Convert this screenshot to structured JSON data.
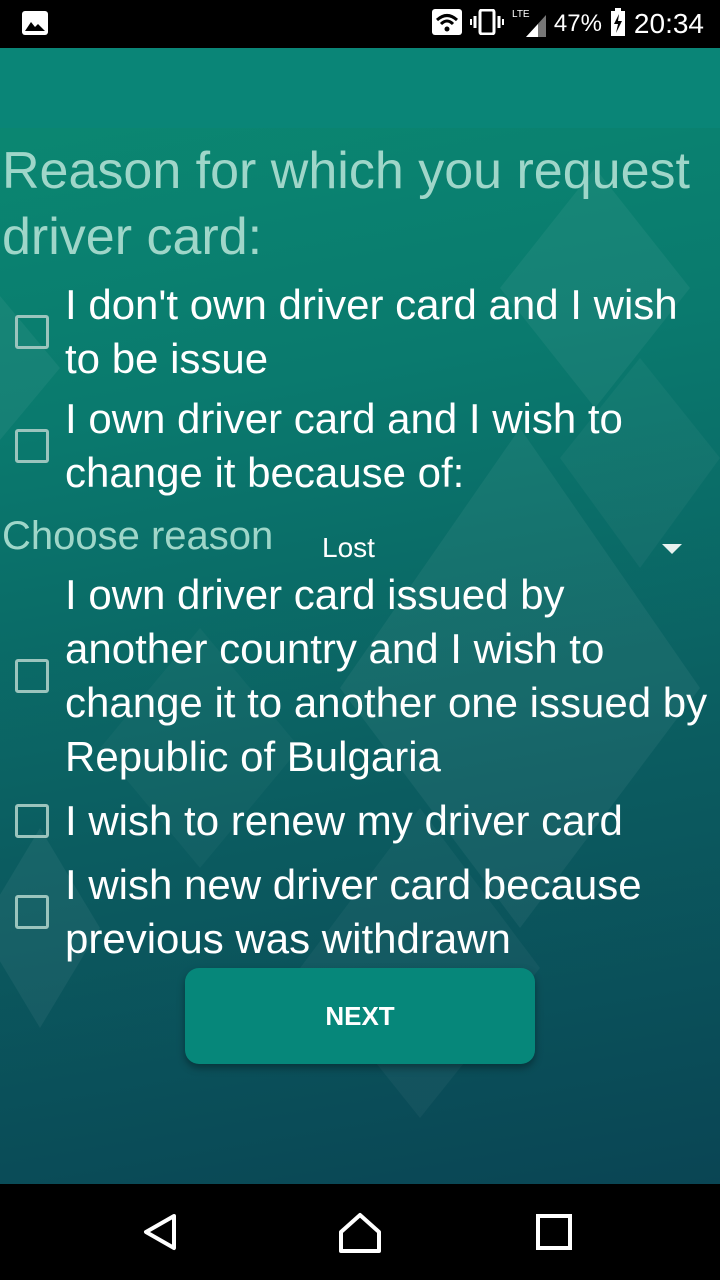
{
  "status_bar": {
    "battery": "47%",
    "time": "20:34",
    "network": "LTE",
    "icons": [
      "gallery-icon",
      "wifi-icon",
      "vibrate-icon",
      "lte-signal-icon",
      "battery-charging-icon"
    ]
  },
  "form": {
    "title": "Reason for which you request driver card:",
    "options": [
      {
        "label": "I don't own driver card and I wish to be issue",
        "checked": false
      },
      {
        "label": "I own driver card and I wish to change it because of:",
        "checked": false
      },
      {
        "label": "I own driver card issued by another country and I wish to change it to another one issued by Republic of Bulgaria",
        "checked": false
      },
      {
        "label": "I wish to renew my driver card",
        "checked": false
      },
      {
        "label": "I wish new driver card because previous was withdrawn",
        "checked": false
      }
    ],
    "choose_reason_label": "Choose reason",
    "reason_selected": "Lost",
    "next_label": "NEXT"
  },
  "colors": {
    "accent": "#06877a",
    "appbar": "#0a8577",
    "title_text": "#9fd6c9"
  },
  "nav_bar": {
    "icons": [
      "back-icon",
      "home-icon",
      "recents-icon"
    ]
  }
}
